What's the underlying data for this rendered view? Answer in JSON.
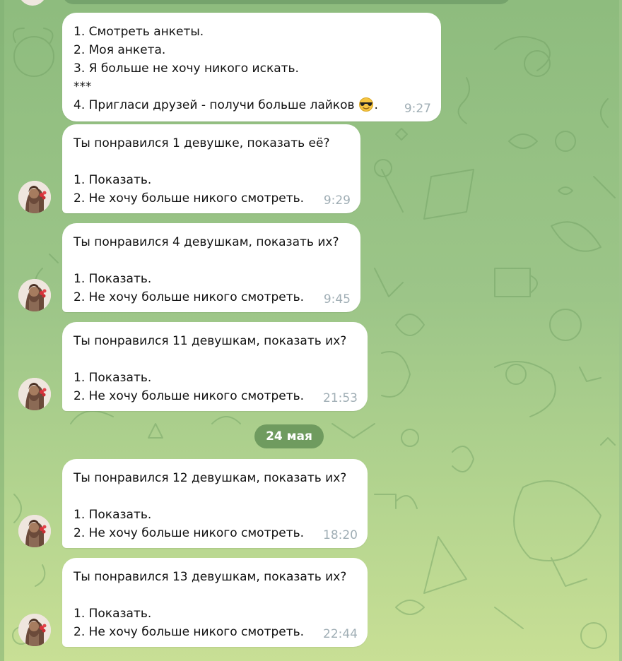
{
  "chat": {
    "colors": {
      "background_top": "#8ebc7e",
      "background_bottom": "#c8df95",
      "bubble": "#ffffff",
      "time": "#a0aeb5",
      "date_pill": "#6f9b5f"
    },
    "messages": [
      {
        "lines": [
          "1. Смотреть анкеты.",
          "2. Моя анкета.",
          "3. Я больше не хочу никого искать.",
          "***",
          "4. Пригласи друзей - получи больше лайков"
        ],
        "emoji": "sunglasses-emoji",
        "trailing": ".",
        "time": "9:27"
      },
      {
        "lines": [
          "Ты понравился 1 девушке, показать её?",
          "",
          "1. Показать.",
          "2. Не хочу больше никого смотреть."
        ],
        "time": "9:29"
      },
      {
        "lines": [
          "Ты понравился 4 девушкам, показать их?",
          "",
          "1. Показать.",
          "2. Не хочу больше никого смотреть."
        ],
        "time": "9:45"
      },
      {
        "lines": [
          "Ты понравился 11 девушкам, показать их?",
          "",
          "1. Показать.",
          "2. Не хочу больше никого смотреть."
        ],
        "time": "21:53"
      },
      {
        "lines": [
          "Ты понравился 12 девушкам, показать их?",
          "",
          "1. Показать.",
          "2. Не хочу больше никого смотреть."
        ],
        "time": "18:20"
      },
      {
        "lines": [
          "Ты понравился 13 девушкам, показать их?",
          "",
          "1. Показать.",
          "2. Не хочу больше никого смотреть."
        ],
        "time": "22:44"
      }
    ],
    "date_separator": "24 мая"
  }
}
